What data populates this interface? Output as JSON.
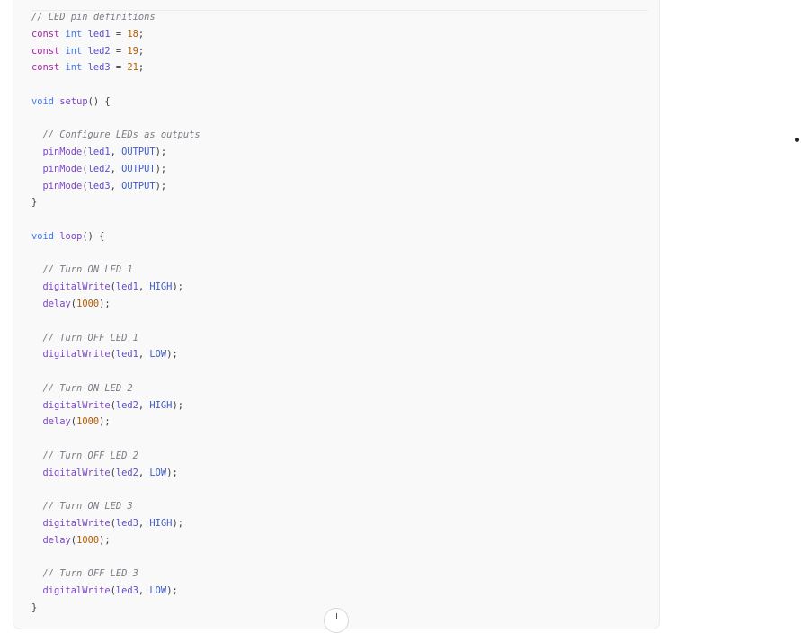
{
  "code_block": {
    "language": "C++ (Arduino)",
    "colors": {
      "background": "#f9f9f9",
      "comment": "#7a7d85",
      "keyword": "#a626a4",
      "type": "#4078f2",
      "variable": "#5a4fc9",
      "number": "#b25b00",
      "function": "#7c47c7",
      "constant": "#3d5cc9"
    },
    "lines": [
      [
        {
          "t": "comment",
          "v": "// LED pin definitions"
        }
      ],
      [
        {
          "t": "kw",
          "v": "const"
        },
        {
          "t": "plain",
          "v": " "
        },
        {
          "t": "type",
          "v": "int"
        },
        {
          "t": "plain",
          "v": " "
        },
        {
          "t": "var",
          "v": "led1"
        },
        {
          "t": "plain",
          "v": " = "
        },
        {
          "t": "num",
          "v": "18"
        },
        {
          "t": "punct",
          "v": ";"
        }
      ],
      [
        {
          "t": "kw",
          "v": "const"
        },
        {
          "t": "plain",
          "v": " "
        },
        {
          "t": "type",
          "v": "int"
        },
        {
          "t": "plain",
          "v": " "
        },
        {
          "t": "var",
          "v": "led2"
        },
        {
          "t": "plain",
          "v": " = "
        },
        {
          "t": "num",
          "v": "19"
        },
        {
          "t": "punct",
          "v": ";"
        }
      ],
      [
        {
          "t": "kw",
          "v": "const"
        },
        {
          "t": "plain",
          "v": " "
        },
        {
          "t": "type",
          "v": "int"
        },
        {
          "t": "plain",
          "v": " "
        },
        {
          "t": "var",
          "v": "led3"
        },
        {
          "t": "plain",
          "v": " = "
        },
        {
          "t": "num",
          "v": "21"
        },
        {
          "t": "punct",
          "v": ";"
        }
      ],
      [],
      [
        {
          "t": "type",
          "v": "void"
        },
        {
          "t": "plain",
          "v": " "
        },
        {
          "t": "fn",
          "v": "setup"
        },
        {
          "t": "punct",
          "v": "() {"
        }
      ],
      [],
      [
        {
          "t": "plain",
          "v": "  "
        },
        {
          "t": "comment",
          "v": "// Configure LEDs as outputs"
        }
      ],
      [
        {
          "t": "plain",
          "v": "  "
        },
        {
          "t": "fn",
          "v": "pinMode"
        },
        {
          "t": "punct",
          "v": "("
        },
        {
          "t": "var",
          "v": "led1"
        },
        {
          "t": "punct",
          "v": ", "
        },
        {
          "t": "const",
          "v": "OUTPUT"
        },
        {
          "t": "punct",
          "v": ");"
        }
      ],
      [
        {
          "t": "plain",
          "v": "  "
        },
        {
          "t": "fn",
          "v": "pinMode"
        },
        {
          "t": "punct",
          "v": "("
        },
        {
          "t": "var",
          "v": "led2"
        },
        {
          "t": "punct",
          "v": ", "
        },
        {
          "t": "const",
          "v": "OUTPUT"
        },
        {
          "t": "punct",
          "v": ");"
        }
      ],
      [
        {
          "t": "plain",
          "v": "  "
        },
        {
          "t": "fn",
          "v": "pinMode"
        },
        {
          "t": "punct",
          "v": "("
        },
        {
          "t": "var",
          "v": "led3"
        },
        {
          "t": "punct",
          "v": ", "
        },
        {
          "t": "const",
          "v": "OUTPUT"
        },
        {
          "t": "punct",
          "v": ");"
        }
      ],
      [
        {
          "t": "punct",
          "v": "}"
        }
      ],
      [],
      [
        {
          "t": "type",
          "v": "void"
        },
        {
          "t": "plain",
          "v": " "
        },
        {
          "t": "fn",
          "v": "loop"
        },
        {
          "t": "punct",
          "v": "() {"
        }
      ],
      [],
      [
        {
          "t": "plain",
          "v": "  "
        },
        {
          "t": "comment",
          "v": "// Turn ON LED 1"
        }
      ],
      [
        {
          "t": "plain",
          "v": "  "
        },
        {
          "t": "fn",
          "v": "digitalWrite"
        },
        {
          "t": "punct",
          "v": "("
        },
        {
          "t": "var",
          "v": "led1"
        },
        {
          "t": "punct",
          "v": ", "
        },
        {
          "t": "const",
          "v": "HIGH"
        },
        {
          "t": "punct",
          "v": ");"
        }
      ],
      [
        {
          "t": "plain",
          "v": "  "
        },
        {
          "t": "fn",
          "v": "delay"
        },
        {
          "t": "punct",
          "v": "("
        },
        {
          "t": "num",
          "v": "1000"
        },
        {
          "t": "punct",
          "v": ");"
        }
      ],
      [],
      [
        {
          "t": "plain",
          "v": "  "
        },
        {
          "t": "comment",
          "v": "// Turn OFF LED 1"
        }
      ],
      [
        {
          "t": "plain",
          "v": "  "
        },
        {
          "t": "fn",
          "v": "digitalWrite"
        },
        {
          "t": "punct",
          "v": "("
        },
        {
          "t": "var",
          "v": "led1"
        },
        {
          "t": "punct",
          "v": ", "
        },
        {
          "t": "const",
          "v": "LOW"
        },
        {
          "t": "punct",
          "v": ");"
        }
      ],
      [],
      [
        {
          "t": "plain",
          "v": "  "
        },
        {
          "t": "comment",
          "v": "// Turn ON LED 2"
        }
      ],
      [
        {
          "t": "plain",
          "v": "  "
        },
        {
          "t": "fn",
          "v": "digitalWrite"
        },
        {
          "t": "punct",
          "v": "("
        },
        {
          "t": "var",
          "v": "led2"
        },
        {
          "t": "punct",
          "v": ", "
        },
        {
          "t": "const",
          "v": "HIGH"
        },
        {
          "t": "punct",
          "v": ");"
        }
      ],
      [
        {
          "t": "plain",
          "v": "  "
        },
        {
          "t": "fn",
          "v": "delay"
        },
        {
          "t": "punct",
          "v": "("
        },
        {
          "t": "num",
          "v": "1000"
        },
        {
          "t": "punct",
          "v": ");"
        }
      ],
      [],
      [
        {
          "t": "plain",
          "v": "  "
        },
        {
          "t": "comment",
          "v": "// Turn OFF LED 2"
        }
      ],
      [
        {
          "t": "plain",
          "v": "  "
        },
        {
          "t": "fn",
          "v": "digitalWrite"
        },
        {
          "t": "punct",
          "v": "("
        },
        {
          "t": "var",
          "v": "led2"
        },
        {
          "t": "punct",
          "v": ", "
        },
        {
          "t": "const",
          "v": "LOW"
        },
        {
          "t": "punct",
          "v": ");"
        }
      ],
      [],
      [
        {
          "t": "plain",
          "v": "  "
        },
        {
          "t": "comment",
          "v": "// Turn ON LED 3"
        }
      ],
      [
        {
          "t": "plain",
          "v": "  "
        },
        {
          "t": "fn",
          "v": "digitalWrite"
        },
        {
          "t": "punct",
          "v": "("
        },
        {
          "t": "var",
          "v": "led3"
        },
        {
          "t": "punct",
          "v": ", "
        },
        {
          "t": "const",
          "v": "HIGH"
        },
        {
          "t": "punct",
          "v": ");"
        }
      ],
      [
        {
          "t": "plain",
          "v": "  "
        },
        {
          "t": "fn",
          "v": "delay"
        },
        {
          "t": "punct",
          "v": "("
        },
        {
          "t": "num",
          "v": "1000"
        },
        {
          "t": "punct",
          "v": ");"
        }
      ],
      [],
      [
        {
          "t": "plain",
          "v": "  "
        },
        {
          "t": "comment",
          "v": "// Turn OFF LED 3"
        }
      ],
      [
        {
          "t": "plain",
          "v": "  "
        },
        {
          "t": "fn",
          "v": "digitalWrite"
        },
        {
          "t": "punct",
          "v": "("
        },
        {
          "t": "var",
          "v": "led3"
        },
        {
          "t": "punct",
          "v": ", "
        },
        {
          "t": "const",
          "v": "LOW"
        },
        {
          "t": "punct",
          "v": ");"
        }
      ],
      [
        {
          "t": "punct",
          "v": "}"
        }
      ]
    ]
  },
  "scroll_button": {
    "icon": "arrow-down-icon"
  },
  "side_marker": {
    "icon": "bullet-dot-icon"
  }
}
